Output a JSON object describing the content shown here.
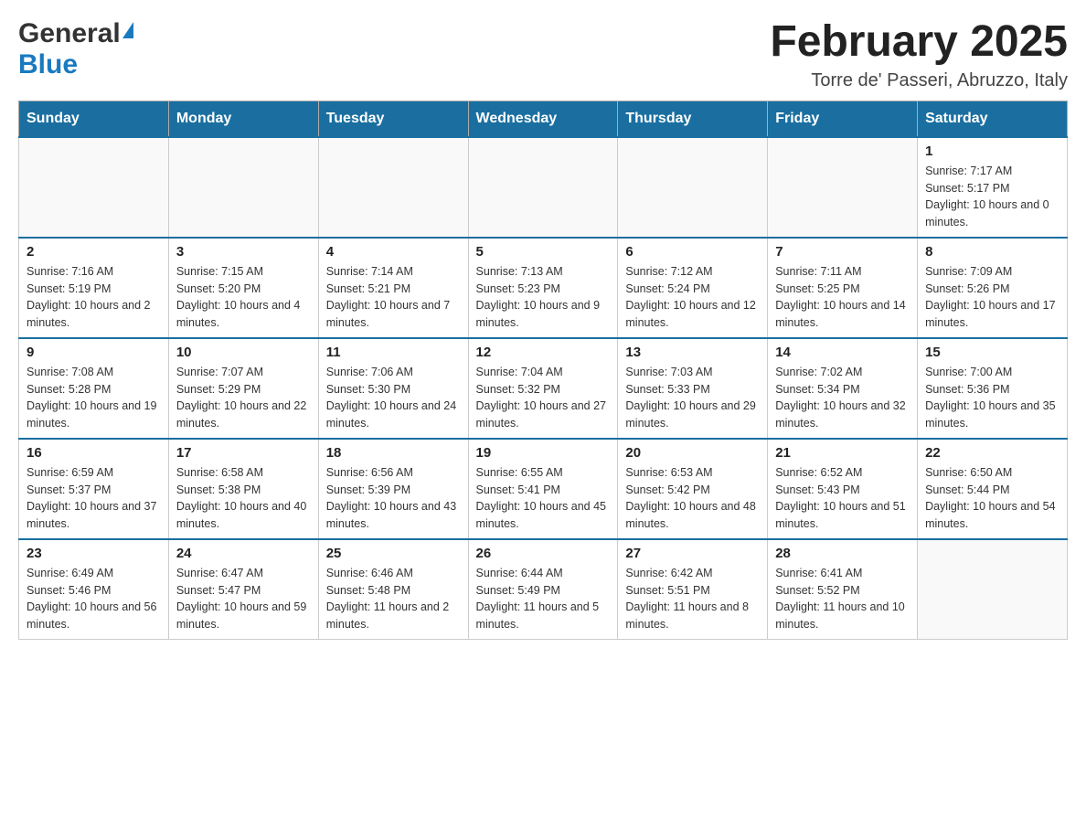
{
  "header": {
    "logo_general": "General",
    "logo_blue": "Blue",
    "month_title": "February 2025",
    "location": "Torre de' Passeri, Abruzzo, Italy"
  },
  "days_of_week": [
    "Sunday",
    "Monday",
    "Tuesday",
    "Wednesday",
    "Thursday",
    "Friday",
    "Saturday"
  ],
  "weeks": [
    [
      {
        "day": "",
        "info": ""
      },
      {
        "day": "",
        "info": ""
      },
      {
        "day": "",
        "info": ""
      },
      {
        "day": "",
        "info": ""
      },
      {
        "day": "",
        "info": ""
      },
      {
        "day": "",
        "info": ""
      },
      {
        "day": "1",
        "info": "Sunrise: 7:17 AM\nSunset: 5:17 PM\nDaylight: 10 hours and 0 minutes."
      }
    ],
    [
      {
        "day": "2",
        "info": "Sunrise: 7:16 AM\nSunset: 5:19 PM\nDaylight: 10 hours and 2 minutes."
      },
      {
        "day": "3",
        "info": "Sunrise: 7:15 AM\nSunset: 5:20 PM\nDaylight: 10 hours and 4 minutes."
      },
      {
        "day": "4",
        "info": "Sunrise: 7:14 AM\nSunset: 5:21 PM\nDaylight: 10 hours and 7 minutes."
      },
      {
        "day": "5",
        "info": "Sunrise: 7:13 AM\nSunset: 5:23 PM\nDaylight: 10 hours and 9 minutes."
      },
      {
        "day": "6",
        "info": "Sunrise: 7:12 AM\nSunset: 5:24 PM\nDaylight: 10 hours and 12 minutes."
      },
      {
        "day": "7",
        "info": "Sunrise: 7:11 AM\nSunset: 5:25 PM\nDaylight: 10 hours and 14 minutes."
      },
      {
        "day": "8",
        "info": "Sunrise: 7:09 AM\nSunset: 5:26 PM\nDaylight: 10 hours and 17 minutes."
      }
    ],
    [
      {
        "day": "9",
        "info": "Sunrise: 7:08 AM\nSunset: 5:28 PM\nDaylight: 10 hours and 19 minutes."
      },
      {
        "day": "10",
        "info": "Sunrise: 7:07 AM\nSunset: 5:29 PM\nDaylight: 10 hours and 22 minutes."
      },
      {
        "day": "11",
        "info": "Sunrise: 7:06 AM\nSunset: 5:30 PM\nDaylight: 10 hours and 24 minutes."
      },
      {
        "day": "12",
        "info": "Sunrise: 7:04 AM\nSunset: 5:32 PM\nDaylight: 10 hours and 27 minutes."
      },
      {
        "day": "13",
        "info": "Sunrise: 7:03 AM\nSunset: 5:33 PM\nDaylight: 10 hours and 29 minutes."
      },
      {
        "day": "14",
        "info": "Sunrise: 7:02 AM\nSunset: 5:34 PM\nDaylight: 10 hours and 32 minutes."
      },
      {
        "day": "15",
        "info": "Sunrise: 7:00 AM\nSunset: 5:36 PM\nDaylight: 10 hours and 35 minutes."
      }
    ],
    [
      {
        "day": "16",
        "info": "Sunrise: 6:59 AM\nSunset: 5:37 PM\nDaylight: 10 hours and 37 minutes."
      },
      {
        "day": "17",
        "info": "Sunrise: 6:58 AM\nSunset: 5:38 PM\nDaylight: 10 hours and 40 minutes."
      },
      {
        "day": "18",
        "info": "Sunrise: 6:56 AM\nSunset: 5:39 PM\nDaylight: 10 hours and 43 minutes."
      },
      {
        "day": "19",
        "info": "Sunrise: 6:55 AM\nSunset: 5:41 PM\nDaylight: 10 hours and 45 minutes."
      },
      {
        "day": "20",
        "info": "Sunrise: 6:53 AM\nSunset: 5:42 PM\nDaylight: 10 hours and 48 minutes."
      },
      {
        "day": "21",
        "info": "Sunrise: 6:52 AM\nSunset: 5:43 PM\nDaylight: 10 hours and 51 minutes."
      },
      {
        "day": "22",
        "info": "Sunrise: 6:50 AM\nSunset: 5:44 PM\nDaylight: 10 hours and 54 minutes."
      }
    ],
    [
      {
        "day": "23",
        "info": "Sunrise: 6:49 AM\nSunset: 5:46 PM\nDaylight: 10 hours and 56 minutes."
      },
      {
        "day": "24",
        "info": "Sunrise: 6:47 AM\nSunset: 5:47 PM\nDaylight: 10 hours and 59 minutes."
      },
      {
        "day": "25",
        "info": "Sunrise: 6:46 AM\nSunset: 5:48 PM\nDaylight: 11 hours and 2 minutes."
      },
      {
        "day": "26",
        "info": "Sunrise: 6:44 AM\nSunset: 5:49 PM\nDaylight: 11 hours and 5 minutes."
      },
      {
        "day": "27",
        "info": "Sunrise: 6:42 AM\nSunset: 5:51 PM\nDaylight: 11 hours and 8 minutes."
      },
      {
        "day": "28",
        "info": "Sunrise: 6:41 AM\nSunset: 5:52 PM\nDaylight: 11 hours and 10 minutes."
      },
      {
        "day": "",
        "info": ""
      }
    ]
  ]
}
